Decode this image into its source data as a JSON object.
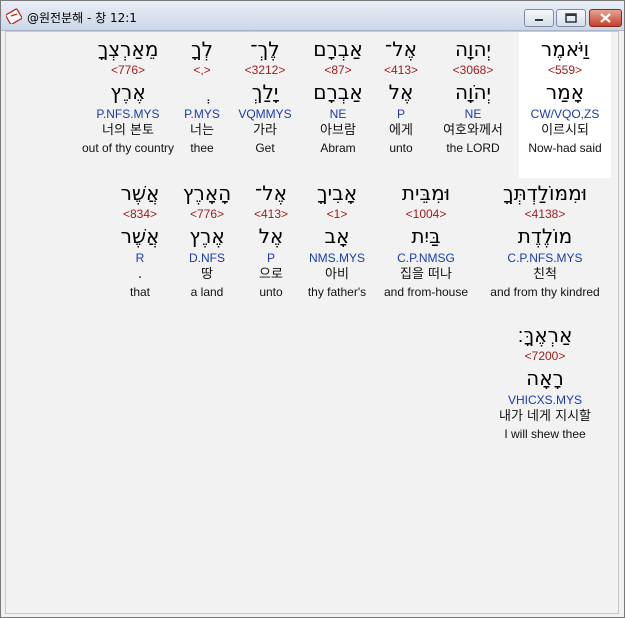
{
  "window": {
    "title": "@원전분해 - 창 12:1",
    "icon": "verse-app-icon"
  },
  "rows": [
    {
      "words": [
        {
          "hebrew": "מֵאַרְצְךָ",
          "number": "<776>",
          "root": "אֶרֶץ",
          "parse": "P.NFS.MYS",
          "korean": "너의 본토",
          "english": "out of thy country"
        },
        {
          "hebrew": "לְךָ",
          "number": "<,>",
          "root": "ְ",
          "parse": "P.MYS",
          "korean": "너는",
          "english": "thee"
        },
        {
          "hebrew": "לֶךְ־",
          "number": "<3212>",
          "root": "יָלַךְ",
          "parse": "VQMMYS",
          "korean": "가라",
          "english": "Get"
        },
        {
          "hebrew": "אַבְרָם",
          "number": "<87>",
          "root": "אַבְרָם",
          "parse": "NE",
          "korean": "아브람",
          "english": "Abram"
        },
        {
          "hebrew": "אֶל־",
          "number": "<413>",
          "root": "אֶל",
          "parse": "P",
          "korean": "에게",
          "english": "unto"
        },
        {
          "hebrew": "יְהוָה",
          "number": "<3068>",
          "root": "יְהֹוָה",
          "parse": "NE",
          "korean": "여호와께서",
          "english": "the LORD"
        },
        {
          "hebrew": "וַיֹּאמֶר",
          "number": "<559>",
          "root": "אָמַר",
          "parse": "CW/VQO,ZS",
          "korean": "이르시되",
          "english": "Now-had said"
        }
      ]
    },
    {
      "words": [
        {
          "hebrew": "אֲשֶׁר",
          "number": "<834>",
          "root": "אֲשֶׁר",
          "parse": "R",
          "korean": ".",
          "english": "that"
        },
        {
          "hebrew": "הָאָרֶץ",
          "number": "<776>",
          "root": "אֶרֶץ",
          "parse": "D.NFS",
          "korean": "땅",
          "english": "a land"
        },
        {
          "hebrew": "אֶל־",
          "number": "<413>",
          "root": "אֶל",
          "parse": "P",
          "korean": "으로",
          "english": "unto"
        },
        {
          "hebrew": "אָבִיךָ",
          "number": "<1>",
          "root": "אָב",
          "parse": "NMS.MYS",
          "korean": "아비",
          "english": "thy father's"
        },
        {
          "hebrew": "וּמִבֵּית",
          "number": "<1004>",
          "root": "בַּיִת",
          "parse": "C.P.NMSG",
          "korean": "집을 떠나",
          "english": "and from-house"
        },
        {
          "hebrew": "וּמִמּוֹלַדְתְּךָ",
          "number": "<4138>",
          "root": "מוֹלֶדֶת",
          "parse": "C.P.NFS.MYS",
          "korean": "친척",
          "english": "and from thy kindred"
        }
      ]
    },
    {
      "words": [
        {
          "hebrew": "אַרְאֶךָּ׃",
          "number": "<7200>",
          "root": "רָאָה",
          "parse": "VHICXS.MYS",
          "korean": "내가 네게 지시할",
          "english": "I will shew thee"
        }
      ]
    }
  ]
}
